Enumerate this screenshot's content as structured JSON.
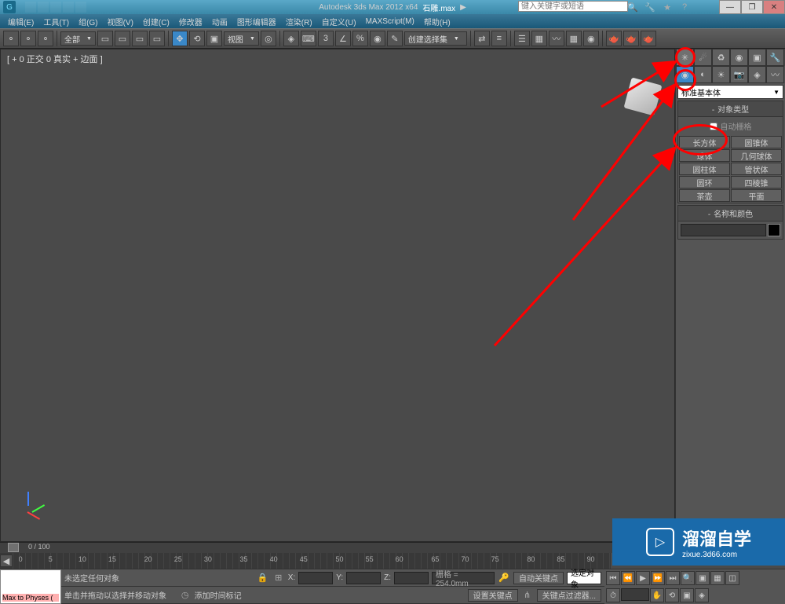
{
  "title": {
    "app": "Autodesk 3ds Max  2012 x64",
    "file": "石雕.max"
  },
  "search": {
    "placeholder": "键入关键字或短语"
  },
  "menu": {
    "items": [
      "编辑(E)",
      "工具(T)",
      "组(G)",
      "视图(V)",
      "创建(C)",
      "修改器",
      "动画",
      "图形编辑器",
      "渲染(R)",
      "自定义(U)",
      "MAXScript(M)",
      "帮助(H)"
    ]
  },
  "toolbar": {
    "filter_dropdown": "全部",
    "view_dropdown": "视图",
    "selection_dropdown": "创建选择集"
  },
  "viewport": {
    "label": "[ + 0 正交 0 真实 + 边面 ]"
  },
  "cmd_panel": {
    "category_dropdown": "标准基本体",
    "section1_header": "对象类型",
    "autogrid_label": "自动栅格",
    "buttons": [
      [
        "长方体",
        "圆锥体"
      ],
      [
        "球体",
        "几何球体"
      ],
      [
        "圆柱体",
        "管状体"
      ],
      [
        "圆环",
        "四棱锥"
      ],
      [
        "茶壶",
        "平面"
      ]
    ],
    "section2_header": "名称和颜色"
  },
  "timeline": {
    "frame_label": "0 / 100",
    "ticks": [
      "0",
      "5",
      "10",
      "15",
      "20",
      "25",
      "30",
      "35",
      "40",
      "45",
      "50",
      "55",
      "60",
      "65",
      "70",
      "75",
      "80",
      "85",
      "90"
    ]
  },
  "status": {
    "script_box_top": "",
    "script_box_bottom": "Max to Physes (",
    "no_selection": "未选定任何对象",
    "hint": "单击并拖动以选择并移动对象",
    "add_time_tag": "添加时间标记",
    "x_label": "X:",
    "y_label": "Y:",
    "z_label": "Z:",
    "grid": "栅格 = 254.0mm",
    "auto_key": "自动关键点",
    "selected_obj": "选定对象",
    "set_key": "设置关键点",
    "key_filter": "关键点过滤器..."
  },
  "watermark": {
    "main": "溜溜自学",
    "sub": "zixue.3d66.com"
  }
}
